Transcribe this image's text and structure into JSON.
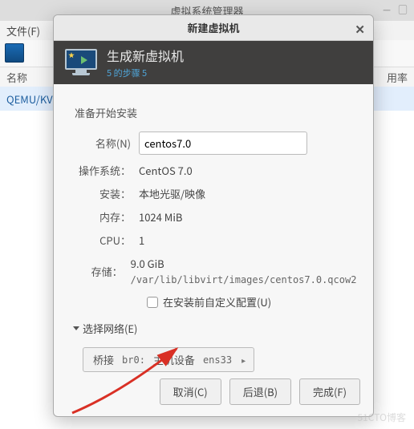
{
  "main_window": {
    "title": "虚拟系统管理器",
    "menu_file": "文件(F)",
    "col_name": "名称",
    "col_usage": "用率",
    "conn_label": "QEMU/KV"
  },
  "dialog": {
    "title": "新建虚拟机",
    "banner_title": "生成新虚拟机",
    "banner_step": "5 的步骤 5",
    "ready": "准备开始安装",
    "name_label": "名称(N)",
    "name_value": "centos7.0",
    "os_label": "操作系统：",
    "os_value": "CentOS 7.0",
    "install_label": "安装：",
    "install_value": "本地光驱/映像",
    "mem_label": "内存：",
    "mem_value": "1024 MiB",
    "cpu_label": "CPU：",
    "cpu_value": "1",
    "storage_label": "存储：",
    "storage_value": "9.0 GiB",
    "storage_path": "/var/lib/libvirt/images/centos7.0.qcow2",
    "customize": "在安装前自定义配置(U)",
    "network_expander": "选择网络(E)",
    "net_bridge": "桥接",
    "net_br": "br0:",
    "net_host": "主机设备",
    "net_dev": "ens33",
    "btn_cancel": "取消(C)",
    "btn_back": "后退(B)",
    "btn_finish": "完成(F)"
  },
  "watermark": "51CTO博客"
}
